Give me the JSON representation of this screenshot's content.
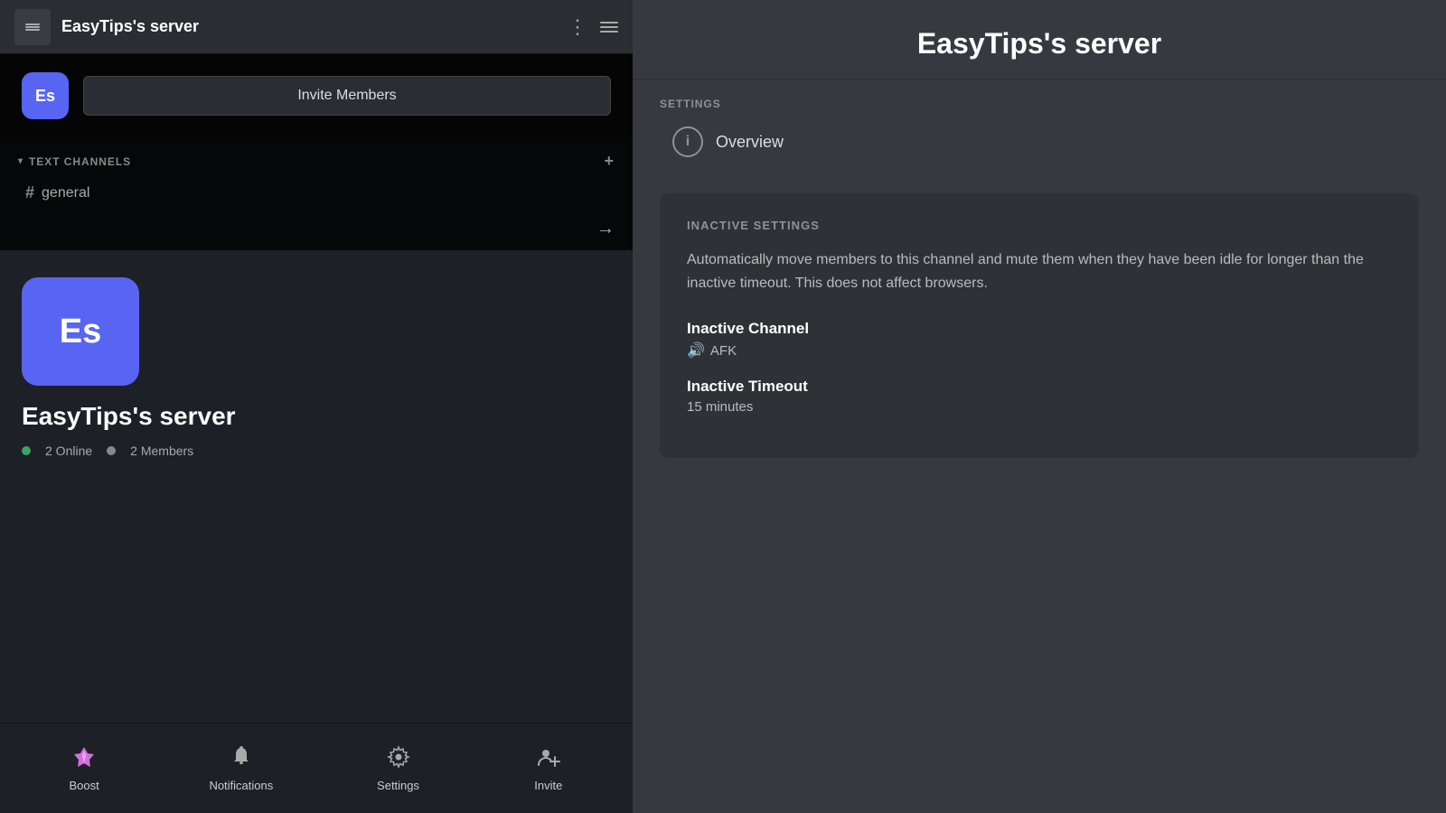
{
  "left": {
    "topBar": {
      "title": "EasyTips's server",
      "iconLabel": "Es"
    },
    "invite": {
      "iconLabel": "Es",
      "buttonLabel": "Invite Members"
    },
    "channels": {
      "sectionLabel": "TEXT CHANNELS",
      "items": [
        {
          "name": "general"
        }
      ]
    },
    "serverProfile": {
      "iconLabel": "Es",
      "serverName": "EasyTips's server",
      "onlineCount": "2 Online",
      "memberCount": "2 Members"
    },
    "bottomNav": {
      "items": [
        {
          "id": "boost",
          "label": "Boost",
          "icon": "boost"
        },
        {
          "id": "notifications",
          "label": "Notifications",
          "icon": "bell"
        },
        {
          "id": "settings",
          "label": "Settings",
          "icon": "gear"
        },
        {
          "id": "invite",
          "label": "Invite",
          "icon": "person-plus"
        }
      ]
    }
  },
  "right": {
    "header": {
      "title": "EasyTips's server"
    },
    "settingsLabel": "SETTINGS",
    "navItems": [
      {
        "id": "overview",
        "label": "Overview"
      }
    ],
    "inactiveSettings": {
      "sectionLabel": "INACTIVE SETTINGS",
      "description": "Automatically move members to this channel and mute them when they have been idle for longer than the inactive timeout. This does not affect browsers.",
      "fields": [
        {
          "label": "Inactive Channel",
          "value": "AFK",
          "valueIcon": "speaker"
        },
        {
          "label": "Inactive Timeout",
          "value": "15 minutes",
          "valueIcon": null
        }
      ]
    }
  }
}
